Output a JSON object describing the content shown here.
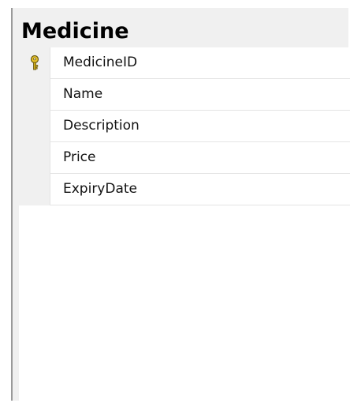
{
  "table": {
    "title": "Medicine",
    "columns": [
      {
        "name": "MedicineID",
        "primary_key": true,
        "icon": "key-icon"
      },
      {
        "name": "Name",
        "primary_key": false
      },
      {
        "name": "Description",
        "primary_key": false
      },
      {
        "name": "Price",
        "primary_key": false
      },
      {
        "name": "ExpiryDate",
        "primary_key": false
      }
    ]
  },
  "colors": {
    "header_bg": "#f0f0f0",
    "grid_bg": "#ffffff",
    "row_line": "#e4e4e4",
    "key_gold": "#d8b21a"
  }
}
